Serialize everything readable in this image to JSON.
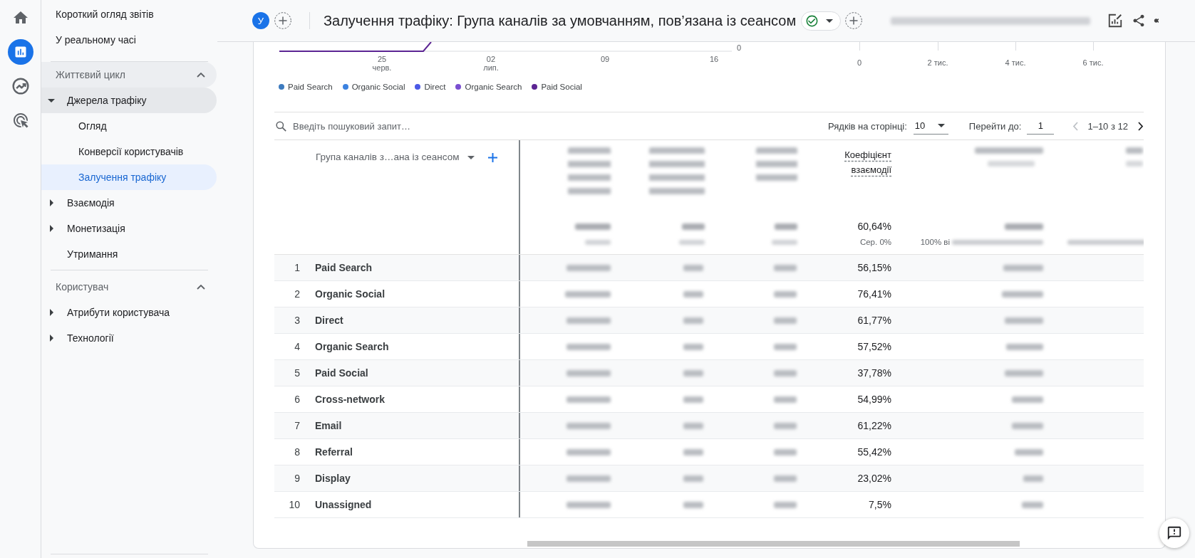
{
  "rail": {
    "items": [
      {
        "selected": false
      },
      {
        "selected": true
      },
      {
        "selected": false
      },
      {
        "selected": false
      }
    ]
  },
  "nav": {
    "top_links": [
      {
        "label": "Короткий огляд звітів",
        "selected": false
      },
      {
        "label": "У реальному часі",
        "selected": false
      }
    ],
    "sections": [
      {
        "title": "Життєвий цикл",
        "expanded": true,
        "highlighted": true,
        "items": [
          {
            "label": "Джерела трафіку",
            "expanded": true,
            "highlighted": true,
            "selected": false,
            "children": [
              {
                "label": "Огляд",
                "selected": false
              },
              {
                "label": "Конверсії користувачів",
                "selected": false
              },
              {
                "label": "Залучення трафіку",
                "selected": true
              }
            ]
          },
          {
            "label": "Взаємодія",
            "expanded": false,
            "highlighted": false,
            "selected": false
          },
          {
            "label": "Монетизація",
            "expanded": false,
            "highlighted": false,
            "selected": false
          },
          {
            "label": "Утримання",
            "highlighted": false,
            "selected": false
          }
        ]
      },
      {
        "title": "Користувач",
        "expanded": true,
        "highlighted": false,
        "items": [
          {
            "label": "Атрибути користувача",
            "expanded": false,
            "highlighted": false,
            "selected": false
          },
          {
            "label": "Технології",
            "expanded": false,
            "highlighted": false,
            "selected": false
          }
        ]
      }
    ]
  },
  "header": {
    "avatar": "У",
    "title": "Залучення трафіку: Група каналів за умовчанням, пов’язана із сеансом"
  },
  "chart_fragment": {
    "line_x_ticks": [
      {
        "day": "25",
        "month": "черв."
      },
      {
        "day": "02",
        "month": "лип."
      },
      {
        "day": "09"
      },
      {
        "day": "16"
      }
    ],
    "line_y_tick": "0",
    "bar_x_ticks": [
      "0",
      "2 тис.",
      "4 тис.",
      "6 тис."
    ],
    "legend": [
      {
        "label": "Paid Search",
        "color": "#3d7bbf"
      },
      {
        "label": "Organic Social",
        "color": "#3b82e0"
      },
      {
        "label": "Direct",
        "color": "#4b59e6"
      },
      {
        "label": "Organic Search",
        "color": "#7a4fd1"
      },
      {
        "label": "Paid Social",
        "color": "#5c2593"
      }
    ]
  },
  "toolbar": {
    "search": {
      "placeholder": "Введіть пошуковий запит…"
    },
    "rows_per_page": {
      "label": "Рядків на сторінці:",
      "value": "10"
    },
    "go_to": {
      "label": "Перейти до:",
      "value": "1"
    },
    "pager": {
      "range": "1–10 з 12",
      "previous_disabled": true,
      "next_disabled": false
    }
  },
  "table": {
    "dimension_column": "Група каналів з…ана із сеансом",
    "rate_column": {
      "label": "Коефіцієнт взаємодії",
      "total": "60,64%",
      "total_note": "Сер. 0%"
    },
    "next_column_note": "100% ві",
    "rows": [
      {
        "index": "1",
        "channel": "Paid Search",
        "engagement_rate": "56,15%"
      },
      {
        "index": "2",
        "channel": "Organic Social",
        "engagement_rate": "76,41%"
      },
      {
        "index": "3",
        "channel": "Direct",
        "engagement_rate": "61,77%"
      },
      {
        "index": "4",
        "channel": "Organic Search",
        "engagement_rate": "57,52%"
      },
      {
        "index": "5",
        "channel": "Paid Social",
        "engagement_rate": "37,78%"
      },
      {
        "index": "6",
        "channel": "Cross-network",
        "engagement_rate": "54,99%"
      },
      {
        "index": "7",
        "channel": "Email",
        "engagement_rate": "61,22%"
      },
      {
        "index": "8",
        "channel": "Referral",
        "engagement_rate": "55,42%"
      },
      {
        "index": "9",
        "channel": "Display",
        "engagement_rate": "23,02%"
      },
      {
        "index": "10",
        "channel": "Unassigned",
        "engagement_rate": "7,5%"
      }
    ]
  }
}
